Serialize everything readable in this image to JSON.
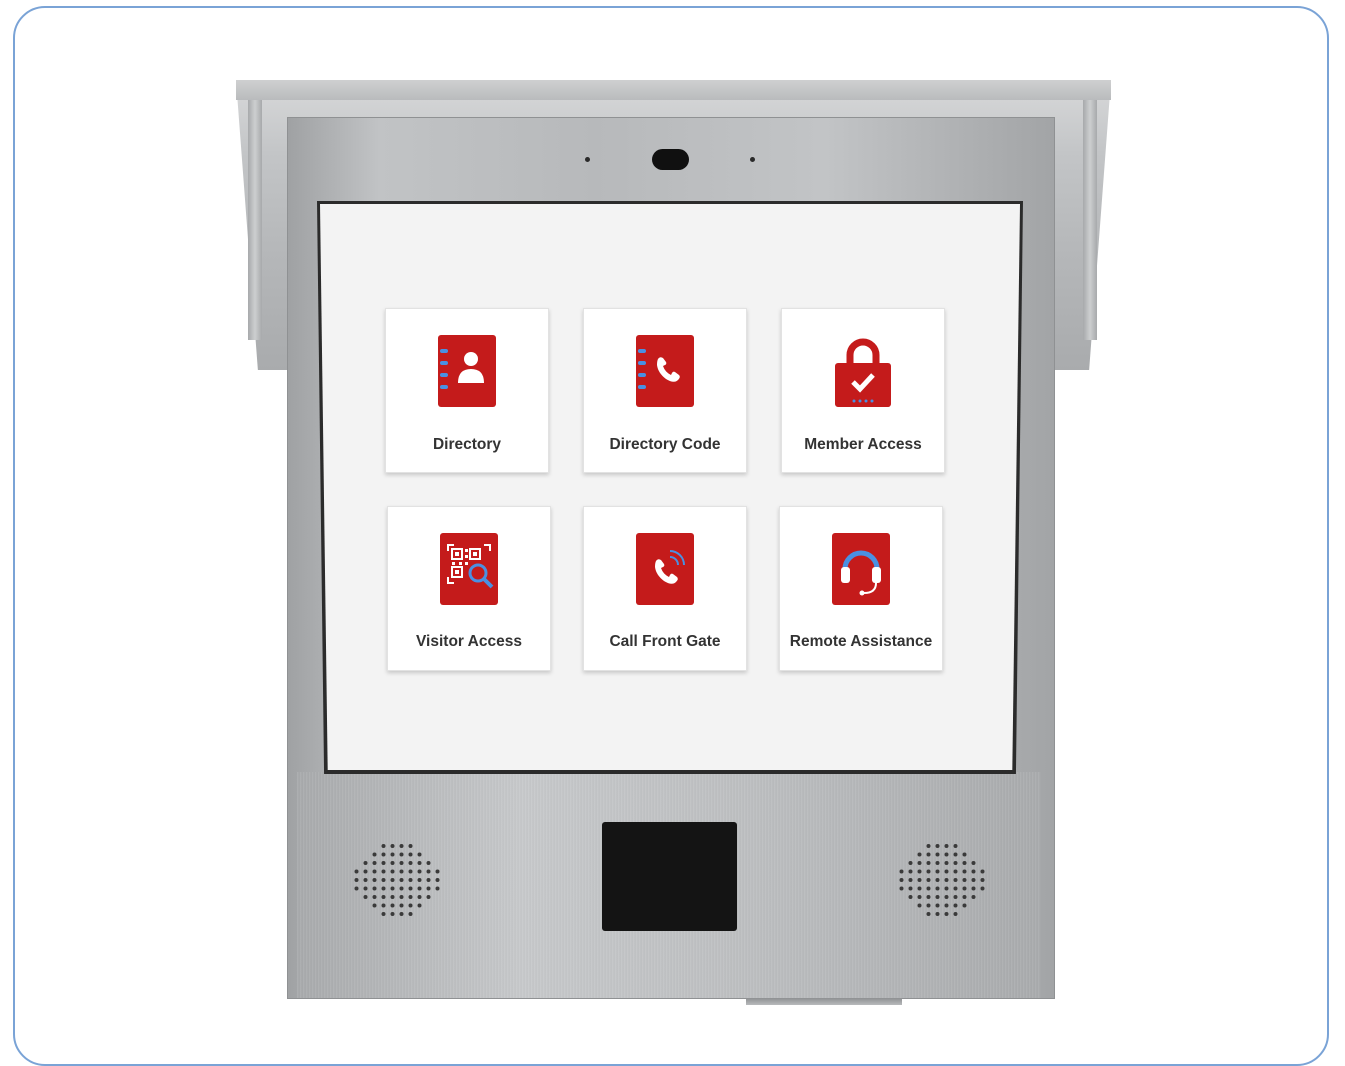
{
  "tiles": [
    {
      "label": "Directory",
      "icon": "directory-contact-book-icon"
    },
    {
      "label": "Directory Code",
      "icon": "directory-phone-book-icon"
    },
    {
      "label": "Member Access",
      "icon": "padlock-check-icon"
    },
    {
      "label": "Visitor Access",
      "icon": "qr-code-search-icon"
    },
    {
      "label": "Call Front Gate",
      "icon": "phone-call-icon"
    },
    {
      "label": "Remote Assistance",
      "icon": "headset-icon"
    }
  ],
  "colors": {
    "icon_red": "#c41b1b",
    "accent_blue": "#4a90e2",
    "screen_bg": "#f3f3f3",
    "tile_text": "#333333"
  }
}
